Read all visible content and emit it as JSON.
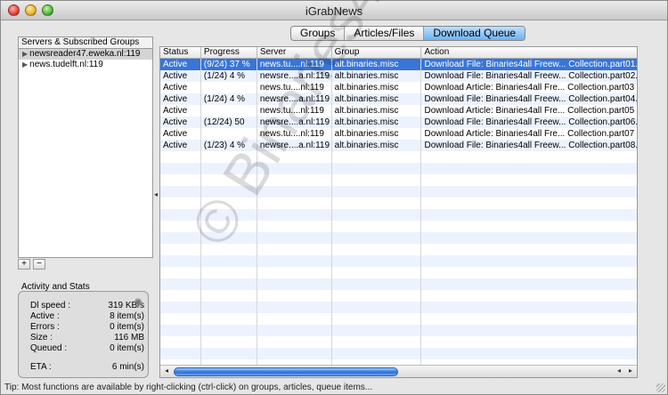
{
  "window": {
    "title": "iGrabNews"
  },
  "tabs": [
    {
      "label": "Groups"
    },
    {
      "label": "Articles/Files"
    },
    {
      "label": "Download Queue"
    }
  ],
  "sidebar": {
    "title": "Servers & Subscribed Groups",
    "servers": [
      {
        "label": "newsreader47.eweka.nl:119"
      },
      {
        "label": "news.tudelft.nl:119"
      }
    ],
    "add_label": "+",
    "remove_label": "−"
  },
  "stats": {
    "title": "Activity and Stats",
    "rows": [
      {
        "label": "Dl speed :",
        "value": "319 KB/s"
      },
      {
        "label": "Active :",
        "value": "8 item(s)"
      },
      {
        "label": "Errors :",
        "value": "0 item(s)"
      },
      {
        "label": "Size :",
        "value": "116 MB"
      },
      {
        "label": "Queued :",
        "value": "0 item(s)"
      },
      {
        "label": "ETA :",
        "value": "6 min(s)"
      }
    ]
  },
  "queue": {
    "columns": [
      "Status",
      "Progress",
      "Server",
      "Group",
      "Action"
    ],
    "rows": [
      [
        "Active",
        "(9/24) 37 %",
        "news.tu....nl:119",
        "alt.binaries.misc",
        "Download File: Binaries4all Freew... Collection.part01."
      ],
      [
        "Active",
        "(1/24) 4 %",
        "newsre....a.nl:119",
        "alt.binaries.misc",
        "Download File: Binaries4all Freew... Collection.part02."
      ],
      [
        "Active",
        "",
        "news.tu....nl:119",
        "alt.binaries.misc",
        "Download Article: Binaries4all Fre... Collection.part03"
      ],
      [
        "Active",
        "(1/24) 4 %",
        "newsre....a.nl:119",
        "alt.binaries.misc",
        "Download File: Binaries4all Freew... Collection.part04."
      ],
      [
        "Active",
        "",
        "news.tu....nl:119",
        "alt.binaries.misc",
        "Download Article: Binaries4all Fre... Collection.part05"
      ],
      [
        "Active",
        "(12/24) 50",
        "newsre....a.nl:119",
        "alt.binaries.misc",
        "Download File: Binaries4all Freew... Collection.part06."
      ],
      [
        "Active",
        "",
        "news.tu....nl:119",
        "alt.binaries.misc",
        "Download Article: Binaries4all Fre... Collection.part07"
      ],
      [
        "Active",
        "(1/23) 4 %",
        "newsre....a.nl:119",
        "alt.binaries.misc",
        "Download File: Binaries4all Freew... Collection.part08."
      ]
    ],
    "selected_row": 0,
    "empty_rows": 19
  },
  "watermark": "© Binaries4all",
  "status_tip": "Tip: Most functions are available by right-clicking (ctrl-click) on groups, articles, queue items...",
  "colors": {
    "selection": "#3875d7",
    "alt_row": "#edf3fe",
    "active_tab": "#6fb1f0"
  }
}
